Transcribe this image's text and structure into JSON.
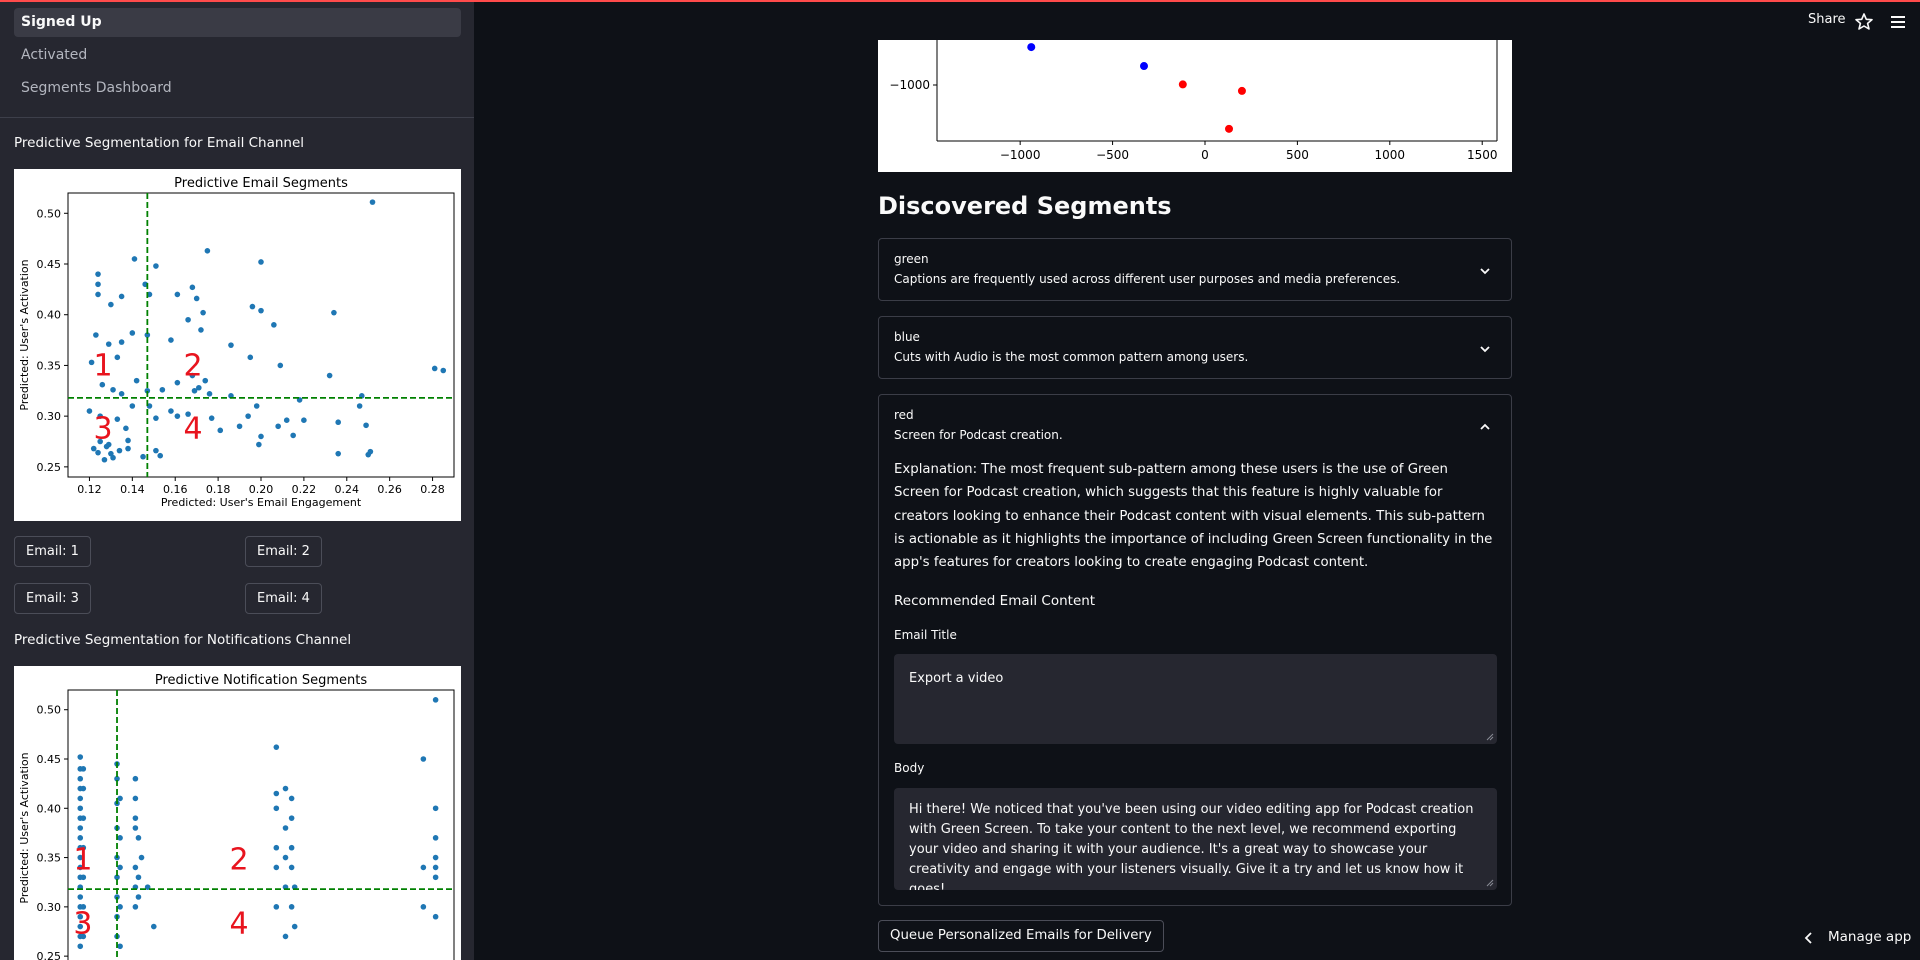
{
  "sidebar": {
    "nav": [
      "Signed Up",
      "Activated",
      "Segments Dashboard"
    ],
    "email_heading": "Predictive Segmentation for Email Channel",
    "notif_heading": "Predictive Segmentation for Notifications Channel",
    "email_buttons": [
      "Email: 1",
      "Email: 2",
      "Email: 3",
      "Email: 4"
    ]
  },
  "header": {
    "share_label": "Share",
    "star_icon": "star-icon",
    "menu_icon": "hamburger-icon"
  },
  "chart_data": [
    {
      "type": "scatter",
      "title": "Predictive Email Segments",
      "xlabel": "Predicted: User's Email Engagement",
      "ylabel": "Predicted: User's Activation",
      "xlim": [
        0.11,
        0.29
      ],
      "ylim": [
        0.24,
        0.52
      ],
      "xticks": [
        "0.12",
        "0.14",
        "0.16",
        "0.18",
        "0.20",
        "0.22",
        "0.24",
        "0.26",
        "0.28"
      ],
      "yticks": [
        "0.25",
        "0.30",
        "0.35",
        "0.40",
        "0.45",
        "0.50"
      ],
      "vline": 0.147,
      "hline": 0.318,
      "quadrant_labels": [
        "1",
        "2",
        "3",
        "4"
      ],
      "color": "#1f77b4",
      "points": [
        [
          0.252,
          0.511
        ],
        [
          0.175,
          0.463
        ],
        [
          0.124,
          0.44
        ],
        [
          0.124,
          0.43
        ],
        [
          0.124,
          0.42
        ],
        [
          0.141,
          0.455
        ],
        [
          0.146,
          0.43
        ],
        [
          0.151,
          0.448
        ],
        [
          0.135,
          0.418
        ],
        [
          0.13,
          0.41
        ],
        [
          0.168,
          0.427
        ],
        [
          0.2,
          0.452
        ],
        [
          0.148,
          0.42
        ],
        [
          0.161,
          0.42
        ],
        [
          0.17,
          0.416
        ],
        [
          0.173,
          0.402
        ],
        [
          0.166,
          0.395
        ],
        [
          0.196,
          0.408
        ],
        [
          0.2,
          0.404
        ],
        [
          0.206,
          0.39
        ],
        [
          0.234,
          0.402
        ],
        [
          0.123,
          0.38
        ],
        [
          0.135,
          0.373
        ],
        [
          0.129,
          0.371
        ],
        [
          0.133,
          0.358
        ],
        [
          0.121,
          0.353
        ],
        [
          0.14,
          0.382
        ],
        [
          0.147,
          0.38
        ],
        [
          0.158,
          0.375
        ],
        [
          0.172,
          0.385
        ],
        [
          0.186,
          0.37
        ],
        [
          0.195,
          0.358
        ],
        [
          0.209,
          0.35
        ],
        [
          0.232,
          0.34
        ],
        [
          0.247,
          0.32
        ],
        [
          0.246,
          0.31
        ],
        [
          0.281,
          0.347
        ],
        [
          0.285,
          0.345
        ],
        [
          0.126,
          0.331
        ],
        [
          0.131,
          0.326
        ],
        [
          0.135,
          0.322
        ],
        [
          0.142,
          0.335
        ],
        [
          0.147,
          0.325
        ],
        [
          0.154,
          0.326
        ],
        [
          0.161,
          0.333
        ],
        [
          0.168,
          0.34
        ],
        [
          0.171,
          0.328
        ],
        [
          0.174,
          0.335
        ],
        [
          0.176,
          0.322
        ],
        [
          0.169,
          0.325
        ],
        [
          0.186,
          0.32
        ],
        [
          0.198,
          0.31
        ],
        [
          0.218,
          0.316
        ],
        [
          0.12,
          0.305
        ],
        [
          0.125,
          0.3
        ],
        [
          0.133,
          0.297
        ],
        [
          0.137,
          0.288
        ],
        [
          0.14,
          0.31
        ],
        [
          0.148,
          0.31
        ],
        [
          0.151,
          0.298
        ],
        [
          0.158,
          0.305
        ],
        [
          0.161,
          0.3
        ],
        [
          0.166,
          0.302
        ],
        [
          0.177,
          0.298
        ],
        [
          0.181,
          0.286
        ],
        [
          0.19,
          0.29
        ],
        [
          0.194,
          0.3
        ],
        [
          0.2,
          0.28
        ],
        [
          0.208,
          0.29
        ],
        [
          0.212,
          0.296
        ],
        [
          0.215,
          0.281
        ],
        [
          0.22,
          0.296
        ],
        [
          0.236,
          0.294
        ],
        [
          0.249,
          0.291
        ],
        [
          0.122,
          0.268
        ],
        [
          0.125,
          0.275
        ],
        [
          0.128,
          0.27
        ],
        [
          0.13,
          0.263
        ],
        [
          0.134,
          0.266
        ],
        [
          0.129,
          0.272
        ],
        [
          0.138,
          0.268
        ],
        [
          0.145,
          0.26
        ],
        [
          0.151,
          0.266
        ],
        [
          0.153,
          0.261
        ],
        [
          0.138,
          0.276
        ],
        [
          0.124,
          0.264
        ],
        [
          0.127,
          0.257
        ],
        [
          0.131,
          0.259
        ],
        [
          0.199,
          0.272
        ],
        [
          0.236,
          0.263
        ],
        [
          0.25,
          0.262
        ],
        [
          0.251,
          0.265
        ]
      ]
    },
    {
      "type": "scatter",
      "title": "Predictive Notification Segments",
      "xlabel": "",
      "ylabel": "Predicted: User's Activation",
      "ylim": [
        0.24,
        0.52
      ],
      "yticks": [
        "0.25",
        "0.30",
        "0.35",
        "0.40",
        "0.45",
        "0.50"
      ],
      "vline": 0.2,
      "hline": 0.318,
      "quadrant_labels": [
        "1",
        "2",
        "3",
        "4"
      ],
      "color": "#1f77b4",
      "points": [
        [
          0.14,
          0.452
        ],
        [
          0.14,
          0.44
        ],
        [
          0.14,
          0.43
        ],
        [
          0.14,
          0.42
        ],
        [
          0.14,
          0.41
        ],
        [
          0.14,
          0.4
        ],
        [
          0.14,
          0.39
        ],
        [
          0.14,
          0.38
        ],
        [
          0.14,
          0.37
        ],
        [
          0.14,
          0.36
        ],
        [
          0.14,
          0.35
        ],
        [
          0.14,
          0.34
        ],
        [
          0.14,
          0.33
        ],
        [
          0.14,
          0.32
        ],
        [
          0.14,
          0.31
        ],
        [
          0.14,
          0.3
        ],
        [
          0.14,
          0.29
        ],
        [
          0.14,
          0.28
        ],
        [
          0.14,
          0.27
        ],
        [
          0.14,
          0.26
        ],
        [
          0.145,
          0.44
        ],
        [
          0.145,
          0.42
        ],
        [
          0.145,
          0.39
        ],
        [
          0.145,
          0.36
        ],
        [
          0.145,
          0.33
        ],
        [
          0.145,
          0.3
        ],
        [
          0.145,
          0.27
        ],
        [
          0.2,
          0.445
        ],
        [
          0.2,
          0.43
        ],
        [
          0.2,
          0.405
        ],
        [
          0.2,
          0.38
        ],
        [
          0.2,
          0.35
        ],
        [
          0.2,
          0.33
        ],
        [
          0.2,
          0.31
        ],
        [
          0.2,
          0.29
        ],
        [
          0.2,
          0.27
        ],
        [
          0.205,
          0.41
        ],
        [
          0.205,
          0.37
        ],
        [
          0.205,
          0.34
        ],
        [
          0.205,
          0.3
        ],
        [
          0.205,
          0.26
        ],
        [
          0.23,
          0.43
        ],
        [
          0.23,
          0.41
        ],
        [
          0.23,
          0.39
        ],
        [
          0.23,
          0.38
        ],
        [
          0.23,
          0.34
        ],
        [
          0.23,
          0.32
        ],
        [
          0.23,
          0.3
        ],
        [
          0.235,
          0.37
        ],
        [
          0.235,
          0.33
        ],
        [
          0.235,
          0.31
        ],
        [
          0.24,
          0.35
        ],
        [
          0.25,
          0.32
        ],
        [
          0.26,
          0.28
        ],
        [
          0.46,
          0.462
        ],
        [
          0.46,
          0.415
        ],
        [
          0.46,
          0.4
        ],
        [
          0.46,
          0.36
        ],
        [
          0.46,
          0.34
        ],
        [
          0.46,
          0.3
        ],
        [
          0.475,
          0.42
        ],
        [
          0.475,
          0.38
        ],
        [
          0.475,
          0.35
        ],
        [
          0.475,
          0.32
        ],
        [
          0.475,
          0.27
        ],
        [
          0.485,
          0.41
        ],
        [
          0.485,
          0.39
        ],
        [
          0.485,
          0.36
        ],
        [
          0.485,
          0.34
        ],
        [
          0.485,
          0.3
        ],
        [
          0.49,
          0.32
        ],
        [
          0.49,
          0.28
        ],
        [
          0.7,
          0.45
        ],
        [
          0.7,
          0.34
        ],
        [
          0.7,
          0.3
        ],
        [
          0.72,
          0.51
        ],
        [
          0.72,
          0.4
        ],
        [
          0.72,
          0.37
        ],
        [
          0.72,
          0.35
        ],
        [
          0.72,
          0.34
        ],
        [
          0.72,
          0.33
        ],
        [
          0.72,
          0.29
        ]
      ]
    },
    {
      "type": "scatter",
      "xticks": [
        "−1000",
        "−500",
        "0",
        "500",
        "1000",
        "1500"
      ],
      "yticks": [
        "−1000"
      ],
      "xlim": [
        -1450,
        1580
      ],
      "points": [
        {
          "x": -940,
          "y": -680,
          "color": "#0000ff"
        },
        {
          "x": -330,
          "y": -840,
          "color": "#0000ff"
        },
        {
          "x": -120,
          "y": -995,
          "color": "#ff0000"
        },
        {
          "x": 200,
          "y": -1050,
          "color": "#ff0000"
        },
        {
          "x": 130,
          "y": -1370,
          "color": "#ff0000"
        }
      ]
    }
  ],
  "main": {
    "segments_title": "Discovered Segments",
    "segments": [
      {
        "name": "green",
        "desc": "Captions are frequently used across different user purposes and media preferences."
      },
      {
        "name": "blue",
        "desc": "Cuts with Audio is the most common pattern among users."
      },
      {
        "name": "red",
        "desc": "Screen for Podcast creation."
      }
    ],
    "explanation": "Explanation: The most frequent sub-pattern among these users is the use of Green Screen for Podcast creation, which suggests that this feature is highly valuable for creators looking to enhance their Podcast content with visual elements. This sub-pattern is actionable as it highlights the importance of including Green Screen functionality in the app's features for creators looking to create engaging Podcast content.",
    "recommended_label": "Recommended Email Content",
    "title_label": "Email Title",
    "title_value": "Export a video",
    "body_label": "Body",
    "body_value": "Hi there! We noticed that you've been using our video editing app for Podcast creation with Green Screen. To take your content to the next level, we recommend exporting your video and sharing it with your audience. It's a great way to showcase your creativity and engage with your listeners visually. Give it a try and let us know how it goes!",
    "queue_button": "Queue Personalized Emails for Delivery"
  },
  "footer": {
    "manage_label": "Manage app"
  }
}
